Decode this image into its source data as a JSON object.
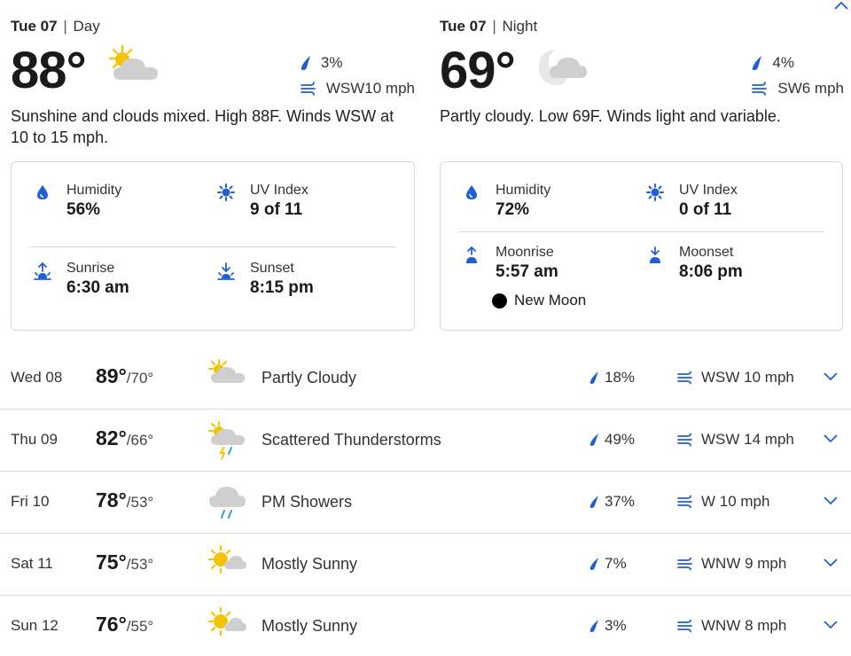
{
  "colors": {
    "accent": "#1f5fd6",
    "sun": "#f5c400",
    "cloud": "#c8c8c8",
    "moon": "#e0e0e0"
  },
  "day": {
    "date": "Tue 07",
    "separator": "|",
    "period": "Day",
    "temp": "88°",
    "icon": "sun-cloud-icon",
    "precip": "3%",
    "wind": "WSW10 mph",
    "narrative": "Sunshine and clouds mixed. High 88F. Winds WSW at 10 to 15 mph.",
    "details": {
      "humidity_label": "Humidity",
      "humidity_value": "56%",
      "uv_label": "UV Index",
      "uv_value": "9 of 11",
      "sunrise_label": "Sunrise",
      "sunrise_value": "6:30 am",
      "sunset_label": "Sunset",
      "sunset_value": "8:15 pm"
    }
  },
  "night": {
    "date": "Tue 07",
    "separator": "|",
    "period": "Night",
    "temp": "69°",
    "icon": "moon-cloud-icon",
    "precip": "4%",
    "wind": "SW6 mph",
    "narrative": "Partly cloudy. Low 69F. Winds light and variable.",
    "details": {
      "humidity_label": "Humidity",
      "humidity_value": "72%",
      "uv_label": "UV Index",
      "uv_value": "0 of 11",
      "moonrise_label": "Moonrise",
      "moonrise_value": "5:57 am",
      "moonset_label": "Moonset",
      "moonset_value": "8:06 pm",
      "moon_phase": "New Moon"
    }
  },
  "forecast": [
    {
      "day": "Wed 08",
      "hi": "89°",
      "lo": "/70°",
      "icon": "partly-cloudy-icon",
      "condition": "Partly Cloudy",
      "precip": "18%",
      "wind": "WSW 10 mph"
    },
    {
      "day": "Thu 09",
      "hi": "82°",
      "lo": "/66°",
      "icon": "thunderstorm-icon",
      "condition": "Scattered Thunderstorms",
      "precip": "49%",
      "wind": "WSW 14 mph"
    },
    {
      "day": "Fri 10",
      "hi": "78°",
      "lo": "/53°",
      "icon": "showers-icon",
      "condition": "PM Showers",
      "precip": "37%",
      "wind": "W 10 mph"
    },
    {
      "day": "Sat 11",
      "hi": "75°",
      "lo": "/53°",
      "icon": "mostly-sunny-icon",
      "condition": "Mostly Sunny",
      "precip": "7%",
      "wind": "WNW 9 mph"
    },
    {
      "day": "Sun 12",
      "hi": "76°",
      "lo": "/55°",
      "icon": "mostly-sunny-icon",
      "condition": "Mostly Sunny",
      "precip": "3%",
      "wind": "WNW 8 mph"
    }
  ]
}
